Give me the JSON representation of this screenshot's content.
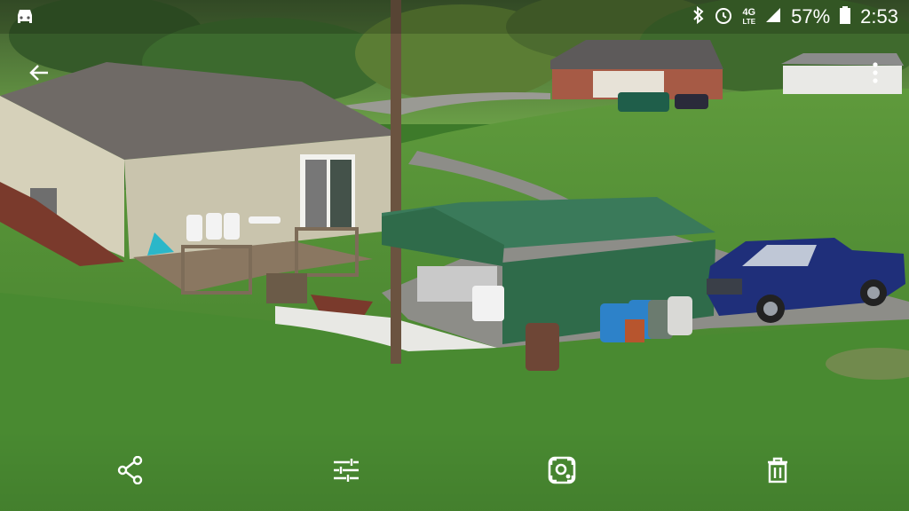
{
  "status_bar": {
    "network_type": "4G",
    "network_sub": "LTE",
    "battery_percent": "57%",
    "time": "2:53",
    "icons": [
      "car-mode-icon",
      "bluetooth-icon",
      "alarm-icon",
      "signal-icon",
      "battery-icon"
    ]
  },
  "photo": {
    "scene": "house-with-deck-carport-and-pickup-trucks-on-grassy-hill"
  },
  "toolbar": {
    "back_icon": "arrow-left-icon",
    "more_icon": "more-vertical-icon"
  },
  "bottom_actions": [
    {
      "name": "share",
      "icon": "share-icon"
    },
    {
      "name": "edit",
      "icon": "tune-sliders-icon"
    },
    {
      "name": "lens",
      "icon": "lens-icon"
    },
    {
      "name": "delete",
      "icon": "trash-icon"
    }
  ],
  "colors": {
    "grass": "#4d8a33",
    "house_siding": "#c9c4ad",
    "roof": "#6f6a66",
    "carport": "#2f6b4a",
    "truck_blue": "#1f2f7a",
    "icon_color": "#ffffff"
  }
}
